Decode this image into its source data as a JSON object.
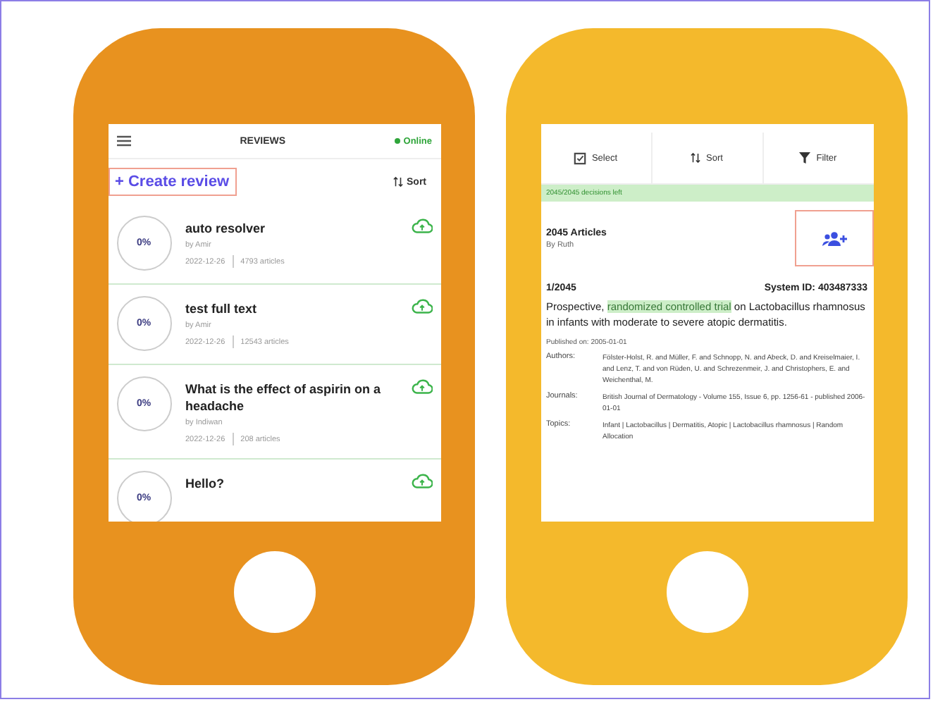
{
  "left_phone": {
    "header": {
      "title": "REVIEWS",
      "status": "Online",
      "online": true
    },
    "create_button": "+ Create review",
    "sort_button": "Sort",
    "reviews": [
      {
        "progress": "0%",
        "title": "auto resolver",
        "author": "by Amir",
        "date": "2022-12-26",
        "articles": "4793 articles"
      },
      {
        "progress": "0%",
        "title": "test full text",
        "author": "by Amir",
        "date": "2022-12-26",
        "articles": "12543 articles"
      },
      {
        "progress": "0%",
        "title": "What is the effect of aspirin on a headache",
        "author": "by Indiwan",
        "date": "2022-12-26",
        "articles": "208 articles"
      },
      {
        "progress": "0%",
        "title": "Hello?"
      }
    ]
  },
  "right_phone": {
    "tabs": [
      {
        "label": "Select",
        "kind": "select"
      },
      {
        "label": "Sort",
        "kind": "sort"
      },
      {
        "label": "Filter",
        "kind": "filter"
      }
    ],
    "banner": "2045/2045 decisions left",
    "set": {
      "title": "2045 Articles",
      "author": "By Ruth"
    },
    "article": {
      "position": "1/2045",
      "system_id": "System ID: 403487333",
      "title_parts": [
        {
          "text": "Prospective, ",
          "highlighted": false
        },
        {
          "text": "randomized controlled trial",
          "highlighted": true
        },
        {
          "text": " on Lactobacillus rhamnosus in infants with moderate to severe atopic dermatitis.",
          "highlighted": false
        }
      ],
      "published": "Published on: 2005-01-01",
      "fields": [
        {
          "label": "Authors:",
          "value": "Fölster-Holst, R. and Müller, F. and Schnopp, N. and Abeck, D. and Kreiselmaier, I. and Lenz, T. and von Rüden, U. and Schrezenmeir, J. and Christophers, E. and Weichenthal, M."
        },
        {
          "label": "Journals:",
          "value": "British Journal of Dermatology - Volume 155, Issue 6, pp. 1256-61 - published 2006-01-01"
        },
        {
          "label": "Topics:",
          "value": "Infant | Lactobacillus | Dermatitis, Atopic | Lactobacillus rhamnosus | Random Allocation"
        }
      ]
    }
  }
}
